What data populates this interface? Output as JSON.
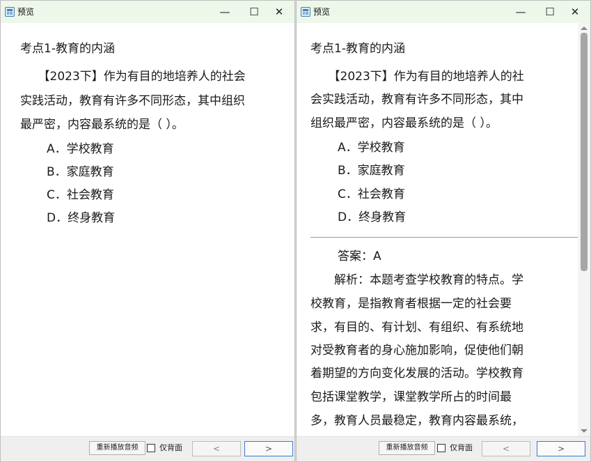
{
  "left_window": {
    "title": "预览",
    "controls": {
      "minimize": "—",
      "maximize": "☐",
      "close": "✕"
    },
    "heading": "考点1-教育的内涵",
    "question_lines": [
      "　　【2023下】作为有目的地培养人的社会",
      "实践活动，教育有许多不同形态，其中组织",
      "最严密，内容最系统的是（ ）。"
    ],
    "options": [
      "A．学校教育",
      "B．家庭教育",
      "C．社会教育",
      "D．终身教育"
    ],
    "bottom": {
      "replay_label": "重新播放音频",
      "back_only_label": "仅背面",
      "prev_label": "<",
      "next_label": ">"
    }
  },
  "right_window": {
    "title": "预览",
    "controls": {
      "minimize": "—",
      "maximize": "☐",
      "close": "✕"
    },
    "heading": "考点1-教育的内涵",
    "question_lines": [
      "　　【2023下】作为有目的地培养人的社",
      "会实践活动，教育有许多不同形态，其中",
      "组织最严密，内容最系统的是（ ）。"
    ],
    "options": [
      "A．学校教育",
      "B．家庭教育",
      "C．社会教育",
      "D．终身教育"
    ],
    "answer": "答案：A",
    "explanation_lines": [
      "　　解析：本题考查学校教育的特点。学",
      "校教育，是指教育者根据一定的社会要",
      "求，有目的、有计划、有组织、有系统地",
      "对受教育者的身心施加影响，促使他们朝",
      "着期望的方向变化发展的活动。学校教育",
      "包括课堂教学，课堂教学所占的时间最",
      "多，教育人员最稳定，教育内容最系统，"
    ],
    "bottom": {
      "replay_label": "重新播放音频",
      "back_only_label": "仅背面",
      "prev_label": "<",
      "next_label": ">"
    }
  }
}
